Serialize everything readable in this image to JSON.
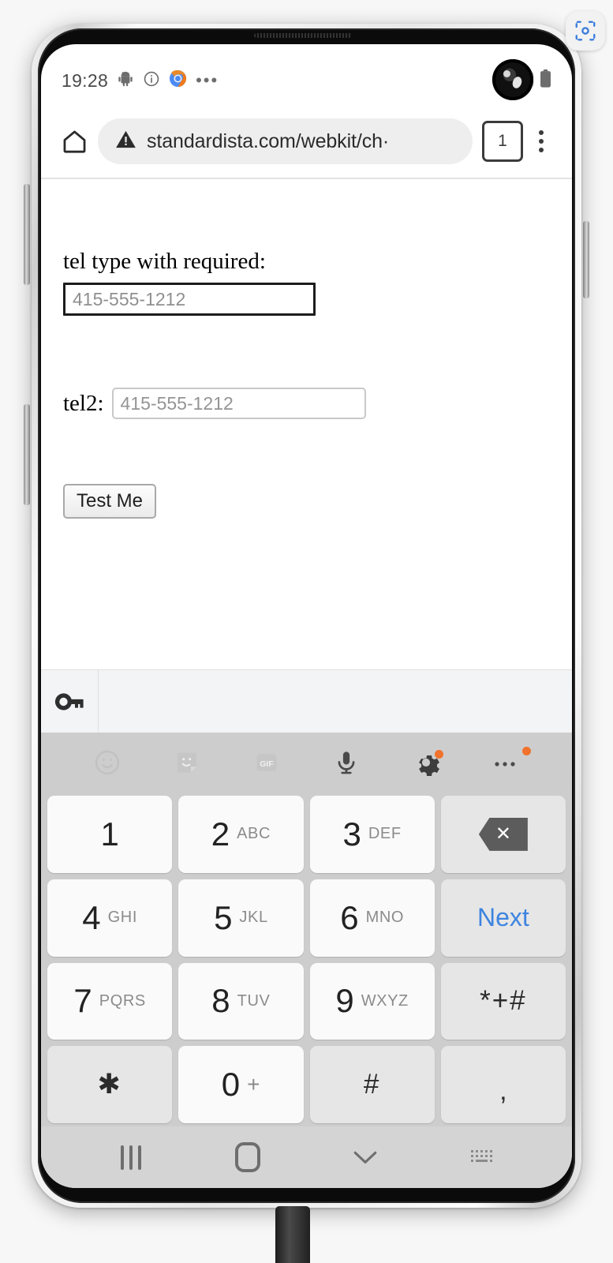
{
  "overlay": {
    "scan_button_icon": "screenshot-scan-icon",
    "accent_color": "#3b7ddd"
  },
  "status_bar": {
    "clock": "19:28",
    "left_icons": [
      "android-robot-icon",
      "info-circle-icon",
      "chrome-browser-icon",
      "more-notifications-icon"
    ],
    "right_icons": [
      "wifi-icon",
      "cellular-signal-icon",
      "battery-icon"
    ]
  },
  "browser": {
    "home_icon": "home-icon",
    "security_icon": "not-secure-warning-icon",
    "url": "standardista.com/webkit/ch·",
    "tab_count": "1",
    "menu_icon": "overflow-menu-icon"
  },
  "page": {
    "tel1_label": "tel type with required:",
    "tel1_placeholder": "415-555-1212",
    "tel1_value": "",
    "tel2_label": "tel2:",
    "tel2_placeholder": "415-555-1212",
    "tel2_value": "",
    "submit_label": "Test Me"
  },
  "autofill": {
    "key_icon": "password-key-icon",
    "suggestion_text": ""
  },
  "keyboard": {
    "toolbar": [
      {
        "name": "emoji-icon",
        "badge": false,
        "dim": true
      },
      {
        "name": "sticker-icon",
        "badge": false,
        "dim": true
      },
      {
        "name": "gif-icon",
        "badge": false,
        "dim": true,
        "label": "GIF"
      },
      {
        "name": "microphone-icon",
        "badge": false,
        "dim": false
      },
      {
        "name": "settings-gear-icon",
        "badge": true,
        "dim": false
      },
      {
        "name": "more-options-icon",
        "badge": true,
        "dim": false
      }
    ],
    "rows": [
      [
        {
          "num": "1",
          "sub": "",
          "type": "digit"
        },
        {
          "num": "2",
          "sub": "ABC",
          "type": "digit"
        },
        {
          "num": "3",
          "sub": "DEF",
          "type": "digit"
        },
        {
          "num": "",
          "sub": "",
          "type": "backspace",
          "icon": "backspace-icon"
        }
      ],
      [
        {
          "num": "4",
          "sub": "GHI",
          "type": "digit"
        },
        {
          "num": "5",
          "sub": "JKL",
          "type": "digit"
        },
        {
          "num": "6",
          "sub": "MNO",
          "type": "digit"
        },
        {
          "num": "",
          "sub": "",
          "type": "action",
          "label": "Next"
        }
      ],
      [
        {
          "num": "7",
          "sub": "PQRS",
          "type": "digit"
        },
        {
          "num": "8",
          "sub": "TUV",
          "type": "digit"
        },
        {
          "num": "9",
          "sub": "WXYZ",
          "type": "digit"
        },
        {
          "num": "",
          "sub": "",
          "type": "symbol",
          "label": "*+#"
        }
      ],
      [
        {
          "num": "",
          "sub": "",
          "type": "symbol",
          "label": "✱"
        },
        {
          "num": "0",
          "sub": "+",
          "type": "digit"
        },
        {
          "num": "",
          "sub": "",
          "type": "symbol",
          "label": "#"
        },
        {
          "num": "",
          "sub": "",
          "type": "symbol",
          "label": ","
        }
      ]
    ],
    "next_key_color": "#3e84e0",
    "badge_color": "#f0722c"
  },
  "nav_bar": {
    "recents_icon": "recent-apps-icon",
    "home_icon": "home-button-icon",
    "back_icon": "dismiss-keyboard-chevron-icon",
    "keyboard_switch_icon": "keyboard-switcher-icon"
  }
}
